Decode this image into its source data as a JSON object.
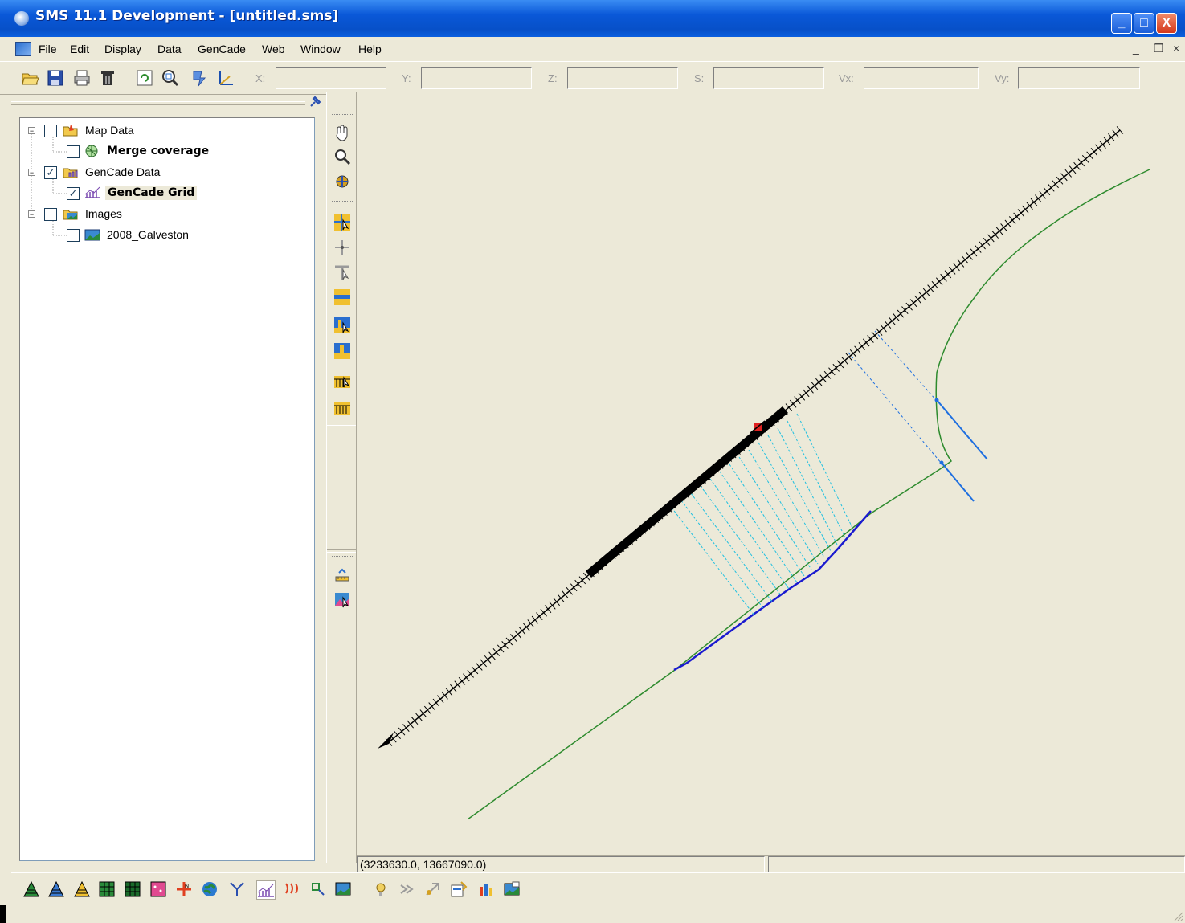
{
  "window": {
    "title": "SMS 11.1 Development - [untitled.sms]",
    "minimize": "_",
    "maximize": "□",
    "close": "X"
  },
  "menu": {
    "items": [
      "File",
      "Edit",
      "Display",
      "Data",
      "GenCade",
      "Web",
      "Window",
      "Help"
    ],
    "mdi_minimize": "_",
    "mdi_restore": "❐",
    "mdi_close": "×"
  },
  "toolbar": {
    "coords": [
      {
        "label": "X:",
        "value": ""
      },
      {
        "label": "Y:",
        "value": ""
      },
      {
        "label": "Z:",
        "value": ""
      },
      {
        "label": "S:",
        "value": ""
      },
      {
        "label": "Vx:",
        "value": ""
      },
      {
        "label": "Vy:",
        "value": ""
      }
    ]
  },
  "tree": {
    "items": [
      {
        "label": "Map Data",
        "checked": false,
        "bold": false,
        "icon": "map-data-icon"
      },
      {
        "label": "Merge coverage",
        "checked": false,
        "bold": true,
        "icon": "coverage-icon"
      },
      {
        "label": "GenCade Data",
        "checked": true,
        "bold": false,
        "icon": "gencade-folder-icon"
      },
      {
        "label": "GenCade Grid",
        "checked": true,
        "bold": true,
        "icon": "gencade-grid-icon"
      },
      {
        "label": "Images",
        "checked": false,
        "bold": false,
        "icon": "images-folder-icon"
      },
      {
        "label": "2008_Galveston",
        "checked": false,
        "bold": false,
        "icon": "image-icon"
      }
    ]
  },
  "status": {
    "coordinates": "(3233630.0, 13667090.0)",
    "cell2": ""
  },
  "colors": {
    "accent": "#0a58d8",
    "grid_line": "#000000",
    "shoreline_green": "#2e8b2e",
    "shoreline_blue": "#1a1acf",
    "transect_cyan": "#20c0e0",
    "structure_blue": "#1e6fe0",
    "marker_red": "#e02020"
  }
}
